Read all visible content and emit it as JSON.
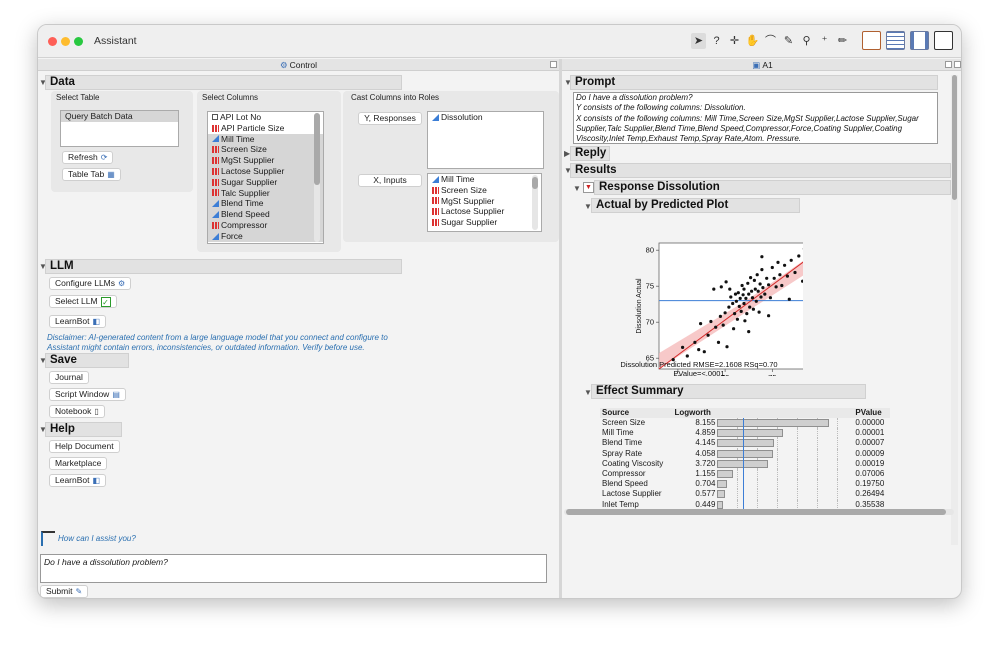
{
  "window": {
    "title": "Assistant"
  },
  "toolbar": {
    "tools": [
      "arrow-cursor-icon",
      "help-icon",
      "crosshair-icon",
      "hand-icon",
      "lasso-icon",
      "brush-icon",
      "magnifier-icon",
      "selection-icon",
      "pencil-icon"
    ]
  },
  "panes": {
    "left_title": "Control",
    "right_title": "A1"
  },
  "data_section": {
    "heading": "Data",
    "select_table_label": "Select Table",
    "tables": [
      "Query Batch Data"
    ],
    "refresh_label": "Refresh",
    "table_tab_label": "Table Tab",
    "select_columns_label": "Select Columns",
    "columns": [
      {
        "name": "API Lot No",
        "type": "nominal-square"
      },
      {
        "name": "API Particle Size",
        "type": "nominal-bar"
      },
      {
        "name": "Mill Time",
        "type": "continuous"
      },
      {
        "name": "Screen Size",
        "type": "nominal-bar"
      },
      {
        "name": "MgSt Supplier",
        "type": "nominal-bar"
      },
      {
        "name": "Lactose Supplier",
        "type": "nominal-bar"
      },
      {
        "name": "Sugar Supplier",
        "type": "nominal-bar"
      },
      {
        "name": "Talc Supplier",
        "type": "nominal-bar"
      },
      {
        "name": "Blend Time",
        "type": "continuous"
      },
      {
        "name": "Blend Speed",
        "type": "continuous"
      },
      {
        "name": "Compressor",
        "type": "nominal-bar"
      },
      {
        "name": "Force",
        "type": "continuous"
      }
    ],
    "cast_label": "Cast Columns into Roles",
    "y_button": "Y, Responses",
    "y_values": [
      {
        "name": "Dissolution",
        "type": "continuous"
      }
    ],
    "x_button": "X, Inputs",
    "x_values": [
      {
        "name": "Mill Time",
        "type": "continuous"
      },
      {
        "name": "Screen Size",
        "type": "nominal-bar"
      },
      {
        "name": "MgSt Supplier",
        "type": "nominal-bar"
      },
      {
        "name": "Lactose Supplier",
        "type": "nominal-bar"
      },
      {
        "name": "Sugar Supplier",
        "type": "nominal-bar"
      }
    ]
  },
  "llm_section": {
    "heading": "LLM",
    "configure_label": "Configure LLMs",
    "select_label": "Select LLM",
    "learnbot_label": "LearnBot",
    "disclaimer": "Disclaimer: AI-generated content from a large language model that you connect and configure to Assistant might contain errors, inconsistencies, or outdated information. Verify before use."
  },
  "save_section": {
    "heading": "Save",
    "journal_label": "Journal",
    "script_label": "Script Window",
    "notebook_label": "Notebook"
  },
  "help_section": {
    "heading": "Help",
    "doc_label": "Help Document",
    "marketplace_label": "Marketplace",
    "learnbot_label": "LearnBot"
  },
  "assistant": {
    "question": "How can I assist you?",
    "input_value": "Do I have a dissolution problem?",
    "submit_label": "Submit"
  },
  "report": {
    "prompt_heading": "Prompt",
    "prompt_lines": [
      "Do I have a dissolution problem?",
      "Y consists of the following columns: Dissolution.",
      "X consists of the following columns: Mill Time,Screen Size,MgSt Supplier,Lactose Supplier,Sugar",
      "Supplier,Talc Supplier,Blend Time,Blend Speed,Compressor,Force,Coating Supplier,Coating",
      "Viscosity,Inlet Temp,Exhaust Temp,Spray Rate,Atom. Pressure."
    ],
    "reply_heading": "Reply",
    "results_heading": "Results",
    "response_heading": "Response Dissolution",
    "plot_heading": "Actual by Predicted Plot",
    "plot_caption_1": "Dissolution Predicted RMSE=2.1608 RSq=0.70",
    "plot_caption_2": "PValue=<.0001",
    "effect_heading": "Effect Summary",
    "effect_columns": [
      "Source",
      "Logworth",
      "",
      "PValue"
    ],
    "effects": [
      {
        "source": "Screen Size",
        "logworth": "8.155",
        "pvalue": "0.00000",
        "lw": 8.155
      },
      {
        "source": "Mill Time",
        "logworth": "4.859",
        "pvalue": "0.00001",
        "lw": 4.859
      },
      {
        "source": "Blend Time",
        "logworth": "4.145",
        "pvalue": "0.00007",
        "lw": 4.145
      },
      {
        "source": "Spray Rate",
        "logworth": "4.058",
        "pvalue": "0.00009",
        "lw": 4.058
      },
      {
        "source": "Coating Viscosity",
        "logworth": "3.720",
        "pvalue": "0.00019",
        "lw": 3.72
      },
      {
        "source": "Compressor",
        "logworth": "1.155",
        "pvalue": "0.07006",
        "lw": 1.155
      },
      {
        "source": "Blend Speed",
        "logworth": "0.704",
        "pvalue": "0.19750",
        "lw": 0.704
      },
      {
        "source": "Lactose Supplier",
        "logworth": "0.577",
        "pvalue": "0.26494",
        "lw": 0.577
      },
      {
        "source": "Inlet Temp",
        "logworth": "0.449",
        "pvalue": "0.35538",
        "lw": 0.449
      }
    ]
  },
  "chart_data": {
    "type": "scatter",
    "title": "Actual by Predicted Plot",
    "xlabel": "Dissolution Predicted RMSE=2.1608 RSq=0.70",
    "ylabel": "Dissolution Actual",
    "xlim": [
      63,
      81
    ],
    "ylim": [
      63.5,
      81
    ],
    "xticks": [
      65,
      70,
      75,
      80
    ],
    "yticks": [
      65,
      70,
      75,
      80
    ],
    "mean_line_y": 73,
    "fit_line": [
      [
        63,
        63.5
      ],
      [
        81,
        81
      ]
    ],
    "points": [
      [
        64.5,
        64.8
      ],
      [
        65.5,
        66.5
      ],
      [
        66,
        65.3
      ],
      [
        66.8,
        67.2
      ],
      [
        67.2,
        66.2
      ],
      [
        67.8,
        65.9
      ],
      [
        68.2,
        68.2
      ],
      [
        68.5,
        70.1
      ],
      [
        69,
        69.3
      ],
      [
        69.3,
        67.2
      ],
      [
        69.5,
        70.8
      ],
      [
        69.8,
        69.6
      ],
      [
        70,
        71.3
      ],
      [
        70.2,
        66.6
      ],
      [
        70.4,
        72.1
      ],
      [
        70.5,
        74.6
      ],
      [
        70.6,
        73.5
      ],
      [
        70.8,
        72.6
      ],
      [
        71,
        71.2
      ],
      [
        71.1,
        73.9
      ],
      [
        71.2,
        72.9
      ],
      [
        71.3,
        70.4
      ],
      [
        71.4,
        74.1
      ],
      [
        71.5,
        72.2
      ],
      [
        71.6,
        73.3
      ],
      [
        71.7,
        71.5
      ],
      [
        71.8,
        75.1
      ],
      [
        71.9,
        73.8
      ],
      [
        72,
        72.6
      ],
      [
        72,
        74.6
      ],
      [
        72.1,
        70.2
      ],
      [
        72.2,
        73.3
      ],
      [
        72.3,
        71.2
      ],
      [
        72.4,
        75.4
      ],
      [
        72.5,
        73.9
      ],
      [
        72.6,
        72.1
      ],
      [
        72.7,
        76.2
      ],
      [
        72.8,
        74.3
      ],
      [
        72.9,
        73.4
      ],
      [
        73,
        71.8
      ],
      [
        73.1,
        75.8
      ],
      [
        73.2,
        74.6
      ],
      [
        73.3,
        72.9
      ],
      [
        73.4,
        76.6
      ],
      [
        73.5,
        74.3
      ],
      [
        73.6,
        71.4
      ],
      [
        73.7,
        75.3
      ],
      [
        73.8,
        73.5
      ],
      [
        73.9,
        77.3
      ],
      [
        74,
        74.8
      ],
      [
        74.2,
        73.9
      ],
      [
        74.4,
        76.1
      ],
      [
        74.6,
        75.2
      ],
      [
        74.8,
        73.4
      ],
      [
        75,
        77.6
      ],
      [
        75.2,
        76.1
      ],
      [
        75.4,
        74.9
      ],
      [
        75.6,
        78.3
      ],
      [
        75.8,
        76.6
      ],
      [
        76,
        75.1
      ],
      [
        76.3,
        77.9
      ],
      [
        76.6,
        76.4
      ],
      [
        77,
        78.6
      ],
      [
        77.4,
        76.9
      ],
      [
        77.8,
        79.2
      ],
      [
        78.2,
        75.7
      ],
      [
        78.6,
        77.4
      ],
      [
        79,
        80.1
      ],
      [
        79.5,
        80.3
      ],
      [
        80,
        79.8
      ],
      [
        68.8,
        74.6
      ],
      [
        69.6,
        74.9
      ],
      [
        70.9,
        69.1
      ],
      [
        72.5,
        68.7
      ],
      [
        74.6,
        70.9
      ],
      [
        76.8,
        73.2
      ],
      [
        78.4,
        80.2
      ],
      [
        67.4,
        69.8
      ],
      [
        70.1,
        75.6
      ],
      [
        73.9,
        79.1
      ]
    ]
  }
}
